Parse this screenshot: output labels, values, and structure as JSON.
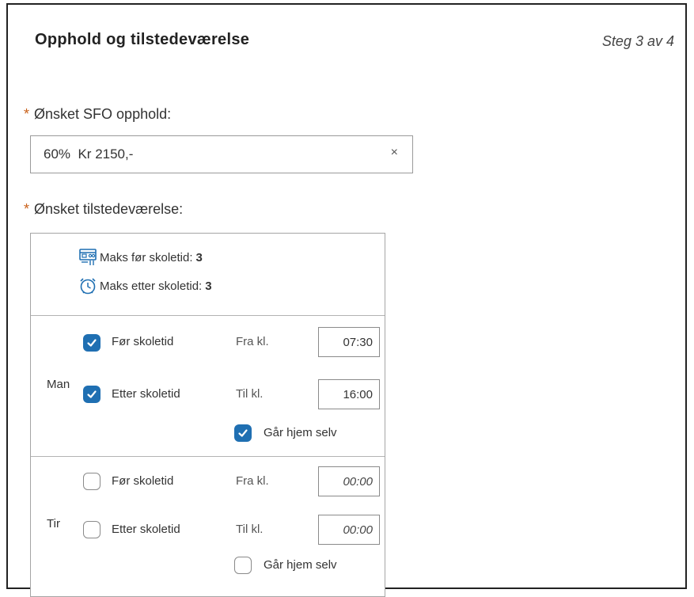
{
  "header": {
    "title": "Opphold og tilstedeværelse",
    "step": "Steg 3 av 4"
  },
  "stay": {
    "required_mark": "*",
    "label": "Ønsket SFO opphold:",
    "value": "60%  Kr 2150,-",
    "clear_glyph": "×"
  },
  "attendance": {
    "required_mark": "*",
    "label": "Ønsket tilstedeværelse:",
    "max_before": {
      "label": "Maks før skoletid:",
      "value": "3",
      "icon": "schedule-icon"
    },
    "max_after": {
      "label": "Maks etter skoletid:",
      "value": "3",
      "icon": "alarm-clock-icon"
    },
    "days": [
      {
        "day": "Man",
        "before_label": "Før skoletid",
        "before_checked": true,
        "from_label": "Fra kl.",
        "from_value": "07:30",
        "after_label": "Etter skoletid",
        "after_checked": true,
        "to_label": "Til kl.",
        "to_value": "16:00",
        "home_label": "Går hjem selv",
        "home_checked": true
      },
      {
        "day": "Tir",
        "before_label": "Før skoletid",
        "before_checked": false,
        "from_label": "Fra kl.",
        "from_value": "00:00",
        "after_label": "Etter skoletid",
        "after_checked": false,
        "to_label": "Til kl.",
        "to_value": "00:00",
        "home_label": "Går hjem selv",
        "home_checked": false
      }
    ]
  },
  "colors": {
    "accent": "#1f6fb2",
    "required": "#c9611a",
    "border": "#9a9a9a"
  }
}
